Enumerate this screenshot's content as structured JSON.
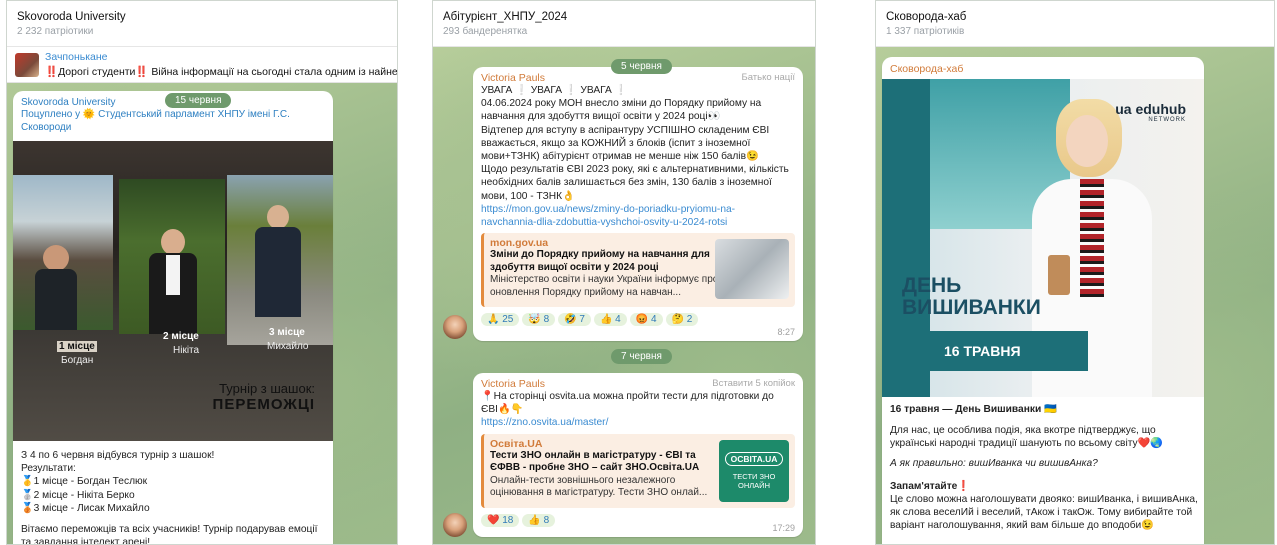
{
  "panel1": {
    "title": "Skovoroda University",
    "subtitle": "2 232 патріотики",
    "pinned": {
      "name": "Зачпонькане",
      "text": "‼️Дорогі студенти‼️ Війна інформації на сьогодні стала одним із найнебе"
    },
    "date": "15 червня",
    "post": {
      "channel": "Skovoroda University",
      "pinned_in": "Поцуплено у 🌞 Студентський парламент ХНПУ імені Г.С. Сковороди",
      "place1_label": "1 місце",
      "place1_name": "Богдан",
      "place2_label": "2 місце",
      "place2_name": "Нікіта",
      "place3_label": "3 місце",
      "place3_name": "Михайло",
      "banner_line1": "Турнір з шашок:",
      "banner_line2": "ПЕРЕМОЖЦІ",
      "text_line1": "З 4 по 6 червня відбувся турнір з шашок!",
      "text_line2": "Результати:",
      "r1": "🥇1 місце - Богдан Теслюк",
      "r2": "🥈2 місце - Нікіта Берко",
      "r3": "🥉3 місце - Лисак Михайло",
      "footer": "Вітаємо переможців та всіх учасників! Турнір подарував емоції та завдання інтелект арені!"
    }
  },
  "panel2": {
    "title": "Абітурієнт_ХНПУ_2024",
    "subtitle": "293 бандеренятка",
    "date1": "5 червня",
    "msg1": {
      "sender": "Victoria Pauls",
      "badge": "Батько нації",
      "lines": [
        "УВАГА ❕ УВАГА ❕ УВАГА ❕",
        "04.06.2024 року МОН внесло зміни до Порядку прийому на",
        "навчання для здобуття вищої освіти у 2024 році👀",
        "Відтепер для вступу в аспірантуру УСПІШНО складеним ЄВІ",
        "вважається, якщо за КОЖНИЙ з блоків (іспит з іноземної",
        "мови+ТЗНК) абітурієнт отримав не менше ніж 150 балів😉",
        "Щодо результатів ЄВІ 2023 року, які є альтернативними, кількість",
        "необхідних балів залишається без змін, 130 балів з іноземної",
        "мови, 100 - ТЗНК👌"
      ],
      "link1": "https://mon.gov.ua/news/zminy-do-poriadku-pryiomu-na-",
      "link2": "navchannia-dlia-zdobuttia-vyshchoi-osvity-u-2024-rotsi",
      "preview_site": "mon.gov.ua",
      "preview_title": "Зміни до Порядку прийому на навчання для здобуття вищої освіти у 2024 році",
      "preview_desc": "Міністерство освіти і науки України інформує про оновлення Порядку прийому на навчан...",
      "reactions": [
        "🙏 25",
        "🤯 8",
        "🤣 7",
        "👍 4",
        "😡 4",
        "🤔 2"
      ],
      "time": "8:27"
    },
    "date2": "7 червня",
    "msg2": {
      "sender": "Victoria Pauls",
      "badge": "Вставити 5 копійок",
      "line1": "📍На сторінці osvita.ua можна пройти тести для підготовки до",
      "line2": "ЄВІ🔥👇",
      "link": "https://zno.osvita.ua/master/",
      "preview_site": "Освіта.UA",
      "preview_title": "Тести ЗНО онлайн в магістратуру - ЄВІ та ЄФВВ - пробне ЗНО – сайт ЗНО.Освіта.UA",
      "preview_desc": "Онлайн-тести зовнішнього незалежного оцінювання в магістратуру. Тести ЗНО онлай...",
      "thumb_brand": "ОСВІТА.UA",
      "thumb_caption": "ТЕСТИ ЗНО ОНЛАЙН",
      "reactions": [
        "❤️ 18",
        "👍 8"
      ],
      "time": "17:29"
    }
  },
  "panel3": {
    "title": "Сковорода-хаб",
    "subtitle": "1 337 патріотиків",
    "sender": "Сковорода-хаб",
    "poster_brand": "ua eduhub",
    "poster_brand_sub": "NETWORK",
    "poster_title1": "ДЕНЬ",
    "poster_title2": "ВИШИВАНКИ",
    "poster_date": "16 ТРАВНЯ",
    "caption": "16 травня — День Вишиванки 🇺🇦",
    "p1": "Для нас, це особлива подія, яка вкотре підтверджує, що українські народні традиції шанують по всьому світу❤️🌏",
    "p2": "А як правильно: вишИванка чи вишивАнка?",
    "remember": "Запам'ятайте❗",
    "p3": "Це слово можна наголошувати двояко: вишИванка, і вишивАнка, як слова веселИй і веселий, тАкож і такОж. Тому вибирайте той варіант наголошування, який вам більше до вподоби😉"
  },
  "colors": {
    "accent": "#3a8bd1",
    "sender": "#d17b3a",
    "chat_bg": "#9dbb8a",
    "poster_teal": "#1d6f78"
  }
}
